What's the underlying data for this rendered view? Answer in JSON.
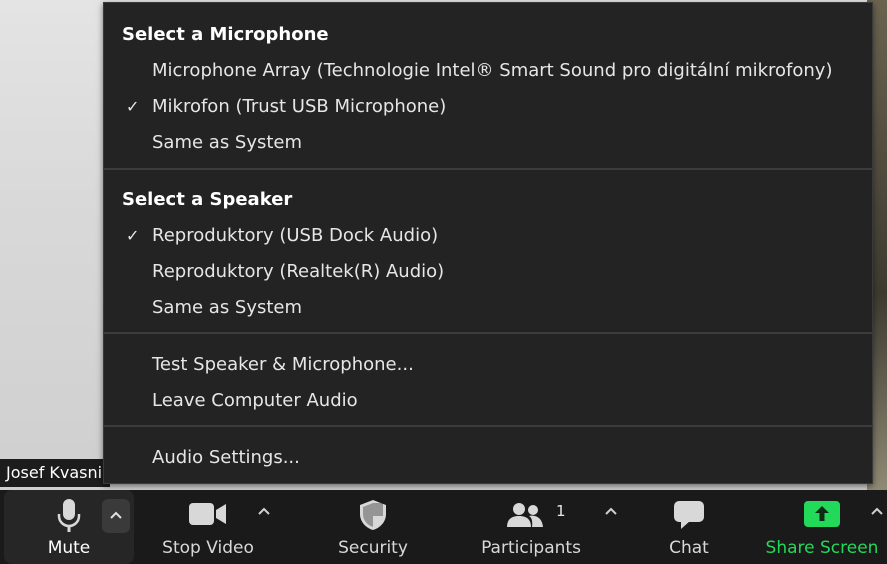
{
  "participant_name": "Josef Kvasnička",
  "menu": {
    "microphone_title": "Select a Microphone",
    "microphones": [
      {
        "label": "Microphone Array (Technologie Intel® Smart Sound pro digitální mikrofony)",
        "checked": false
      },
      {
        "label": "Mikrofon (Trust USB Microphone)",
        "checked": true
      },
      {
        "label": "Same as System",
        "checked": false
      }
    ],
    "speaker_title": "Select a Speaker",
    "speakers": [
      {
        "label": "Reproduktory (USB Dock Audio)",
        "checked": true
      },
      {
        "label": "Reproduktory (Realtek(R) Audio)",
        "checked": false
      },
      {
        "label": "Same as System",
        "checked": false
      }
    ],
    "test_label": "Test Speaker & Microphone...",
    "leave_label": "Leave Computer Audio",
    "settings_label": "Audio Settings...",
    "check_glyph": "✓"
  },
  "toolbar": {
    "mute_label": "Mute",
    "video_label": "Stop Video",
    "security_label": "Security",
    "participants_label": "Participants",
    "participants_count": "1",
    "chat_label": "Chat",
    "share_label": "Share Screen",
    "caret_glyph": "⌃"
  },
  "colors": {
    "share_green": "#23d959",
    "menu_bg": "#232323",
    "toolbar_bg": "#1a1a1a"
  },
  "icons": [
    "microphone-icon",
    "video-camera-icon",
    "shield-icon",
    "participants-icon",
    "chat-bubble-icon",
    "share-screen-icon",
    "caret-up-icon",
    "checkmark-icon"
  ]
}
